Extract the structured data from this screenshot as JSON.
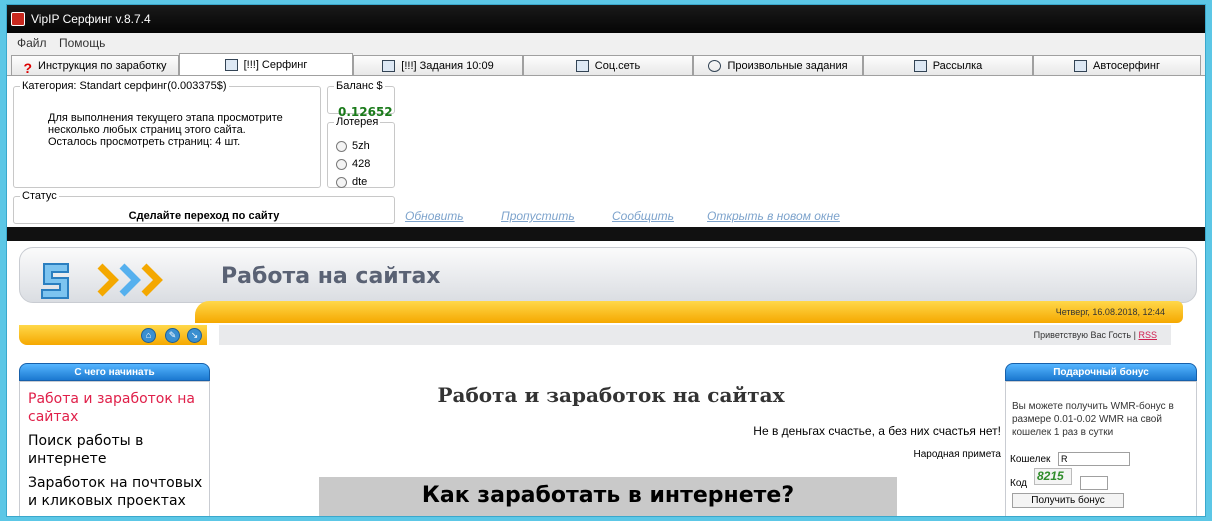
{
  "window": {
    "title": "VipIP Серфинг  v.8.7.4"
  },
  "menu": {
    "items": [
      "Файл",
      "Помощь"
    ]
  },
  "tabs": [
    {
      "label": "Инструкция по заработку",
      "icon": "question-icon"
    },
    {
      "label": "[!!!] Серфинг",
      "icon": "window-icon"
    },
    {
      "label": "[!!!] Задания 10:09",
      "icon": "list-icon"
    },
    {
      "label": "Соц.сеть",
      "icon": "network-icon"
    },
    {
      "label": "Произвольные задания",
      "icon": "globe-icon"
    },
    {
      "label": "Рассылка",
      "icon": "grid-icon"
    },
    {
      "label": "Автосерфинг",
      "icon": "monitor-icon"
    }
  ],
  "category": {
    "legend": "Категория: Standart серфинг(0.003375$)",
    "lines": [
      "Для выполнения текущего этапа просмотрите",
      "несколько любых страниц этого сайта.",
      "Осталось просмотреть страниц: 4 шт."
    ]
  },
  "balance": {
    "legend": "Баланс $",
    "value": "0.12652"
  },
  "lottery": {
    "legend": "Лотерея",
    "options": [
      "5zh",
      "428",
      "dte"
    ]
  },
  "status": {
    "legend": "Статус",
    "text": "Сделайте переход по сайту"
  },
  "actions": {
    "refresh": "Обновить",
    "skip": "Пропустить",
    "report": "Сообщить",
    "open_new": "Открыть в новом окне"
  },
  "site": {
    "title": "Работа на сайтах",
    "date": "Четверг, 16.08.2018, 12:44",
    "greeting": "Приветствую Вас Гость",
    "separator": "|",
    "rss": "RSS",
    "sidebar": {
      "heading": "С чего начинать",
      "items": [
        {
          "label": "Работа и заработок на сайтах",
          "color": "#e0204a"
        },
        {
          "label": "Поиск работы в интернете",
          "color": "#000000"
        },
        {
          "label": "Заработок на почтовых и кликовых проектах",
          "color": "#000000"
        }
      ]
    },
    "main": {
      "heading": "Работа и заработок на сайтах",
      "quote": "Не в деньгах счастье, а без них счастья нет!",
      "quote_author": "Народная примета",
      "banner": "Как заработать в интернете?"
    },
    "bonus": {
      "heading": "Подарочный бонус",
      "text": [
        "Вы можете получить WMR-бонус в",
        "размере 0.01-0.02 WMR на свой",
        "кошелек 1 раз в сутки"
      ],
      "wallet_label": "Кошелек",
      "wallet_value": "R",
      "code_label": "Код",
      "captcha": "8215",
      "button": "Получить бонус"
    }
  }
}
